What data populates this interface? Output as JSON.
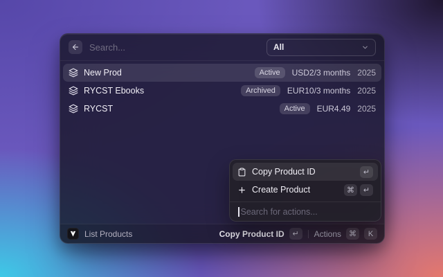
{
  "header": {
    "search_placeholder": "Search...",
    "filter_value": "All"
  },
  "products": [
    {
      "name": "New Prod",
      "status": "Active",
      "price": "USD2/3 months",
      "year": "2025",
      "selected": true
    },
    {
      "name": "RYCST Ebooks",
      "status": "Archived",
      "price": "EUR10/3 months",
      "year": "2025",
      "selected": false
    },
    {
      "name": "RYCST",
      "status": "Active",
      "price": "EUR4.49",
      "year": "2025",
      "selected": false
    }
  ],
  "actions_menu": {
    "items": [
      {
        "label": "Copy Product ID",
        "icon": "clipboard-icon",
        "shortcut": [
          "↵"
        ],
        "selected": true
      },
      {
        "label": "Create Product",
        "icon": "plus-icon",
        "shortcut": [
          "⌘",
          "↵"
        ],
        "selected": false
      }
    ],
    "search_placeholder": "Search for actions..."
  },
  "status_bar": {
    "command_name": "List Products",
    "primary_action": {
      "label": "Copy Product ID",
      "key": "↵"
    },
    "actions": {
      "label": "Actions",
      "keys": [
        "⌘",
        "K"
      ]
    }
  },
  "icons": {
    "back": "arrow-left-icon",
    "filter": "chevron-down-icon",
    "product": "layers-icon",
    "logo": "v-mark-icon"
  },
  "colors": {
    "bg_top_left": "#5647a9",
    "bg_top_right": "#1f1630",
    "bg_bottom_left": "#3ec9e7",
    "bg_bottom_right": "#e5786d",
    "selection": "rgba(255,255,255,0.10)"
  }
}
